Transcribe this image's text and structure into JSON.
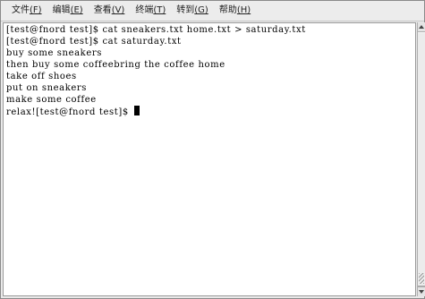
{
  "menu": {
    "items": [
      {
        "label": "文件",
        "mnemonic": "(F)"
      },
      {
        "label": "编辑",
        "mnemonic": "(E)"
      },
      {
        "label": "查看",
        "mnemonic": "(V)"
      },
      {
        "label": "终端",
        "mnemonic": "(T)"
      },
      {
        "label": "转到",
        "mnemonic": "(G)"
      },
      {
        "label": "帮助",
        "mnemonic": "(H)"
      }
    ]
  },
  "terminal": {
    "lines": [
      "[test@fnord test]$ cat sneakers.txt home.txt > saturday.txt",
      "[test@fnord test]$ cat saturday.txt",
      "buy some sneakers",
      "then buy some coffeebring the coffee home",
      "take off shoes",
      "put on sneakers",
      "make some coffee",
      "relax![test@fnord test]$ "
    ]
  },
  "scrollbar": {
    "position": 1.0
  }
}
